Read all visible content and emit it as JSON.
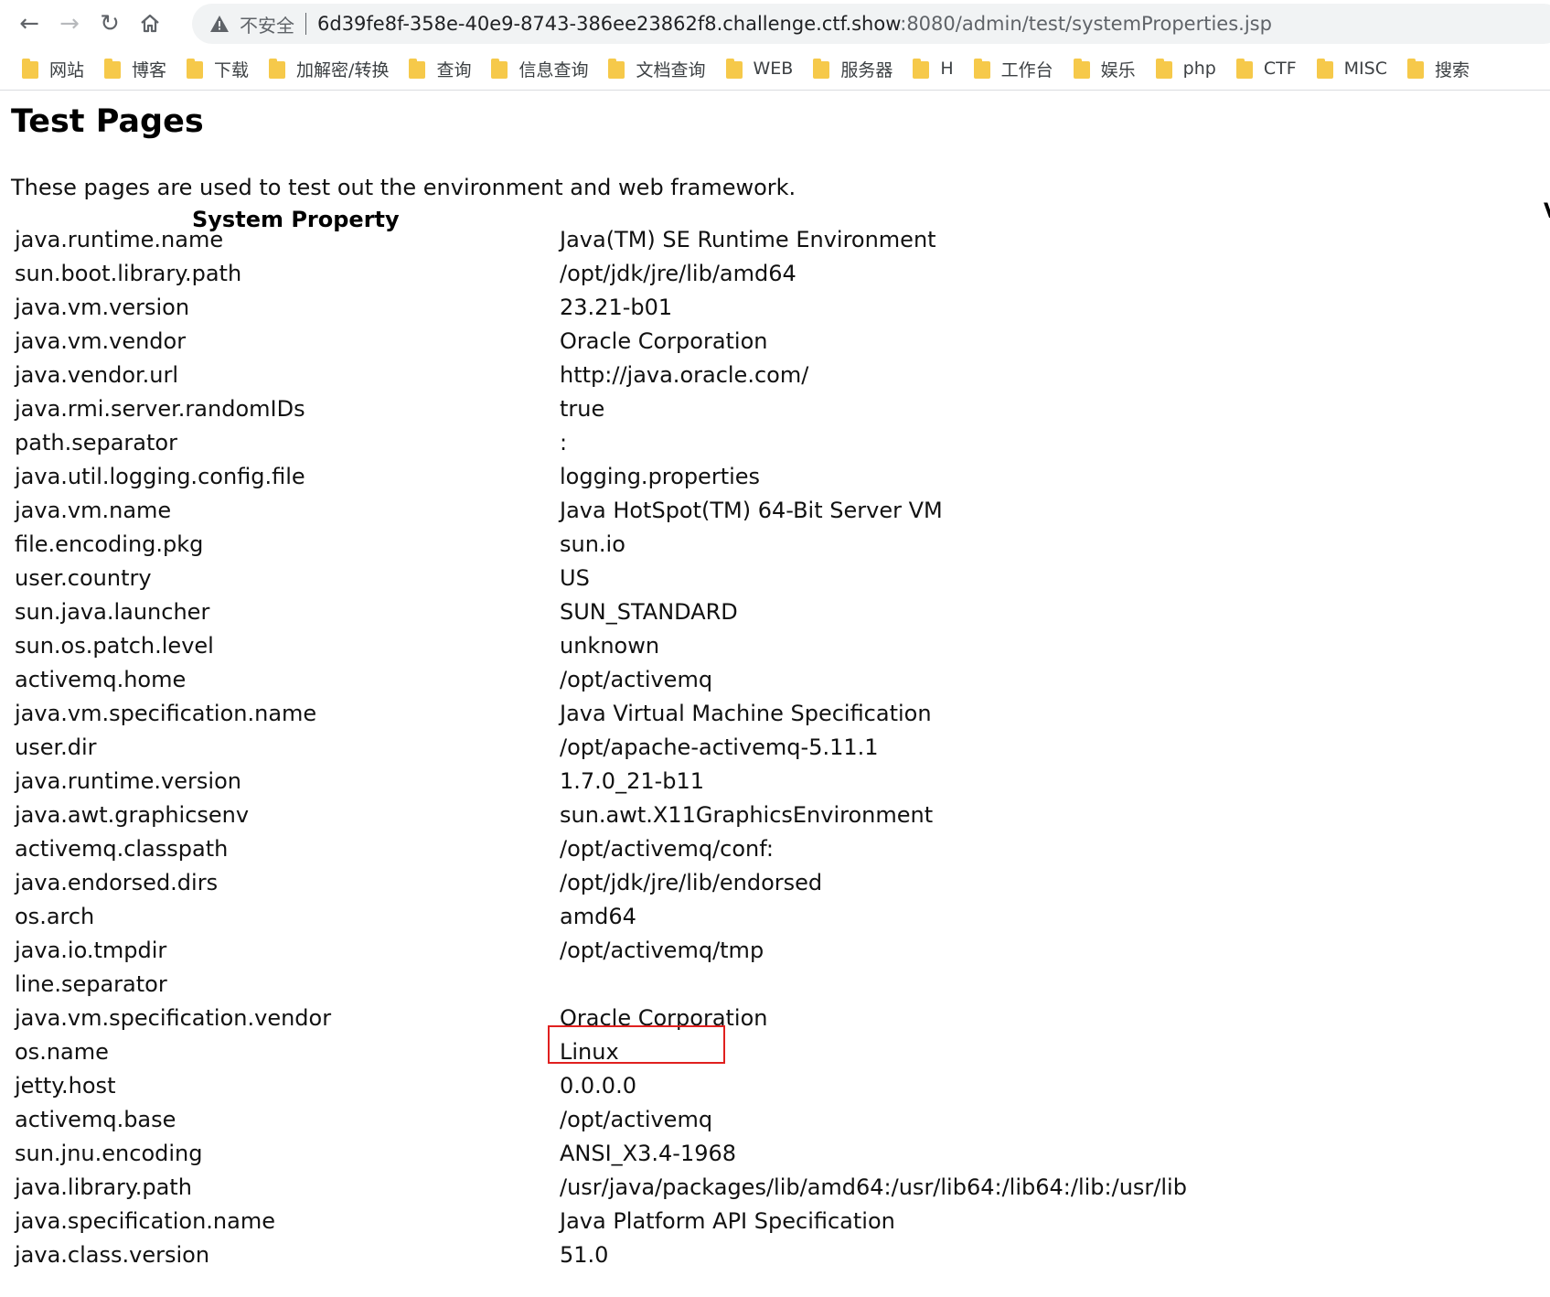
{
  "browser": {
    "security_label": "不安全",
    "url_host": "6d39fe8f-358e-40e9-8743-386ee23862f8.challenge.ctf.show",
    "url_rest": ":8080/admin/test/systemProperties.jsp",
    "bookmarks": [
      "网站",
      "博客",
      "下载",
      "加解密/转换",
      "查询",
      "信息查询",
      "文档查询",
      "WEB",
      "服务器",
      "H",
      "工作台",
      "娱乐",
      "php",
      "CTF",
      "MISC",
      "搜索"
    ]
  },
  "page": {
    "title": "Test Pages",
    "intro": "These pages are used to test out the environment and web framework.",
    "column_header": "System Property",
    "right_sliver": "V"
  },
  "properties": [
    {
      "key": "java.runtime.name",
      "value": "Java(TM) SE Runtime Environment"
    },
    {
      "key": "sun.boot.library.path",
      "value": "/opt/jdk/jre/lib/amd64"
    },
    {
      "key": "java.vm.version",
      "value": "23.21-b01"
    },
    {
      "key": "java.vm.vendor",
      "value": "Oracle Corporation"
    },
    {
      "key": "java.vendor.url",
      "value": "http://java.oracle.com/"
    },
    {
      "key": "java.rmi.server.randomIDs",
      "value": "true"
    },
    {
      "key": "path.separator",
      "value": ":"
    },
    {
      "key": "java.util.logging.config.file",
      "value": "logging.properties"
    },
    {
      "key": "java.vm.name",
      "value": "Java HotSpot(TM) 64-Bit Server VM"
    },
    {
      "key": "file.encoding.pkg",
      "value": "sun.io"
    },
    {
      "key": "user.country",
      "value": "US"
    },
    {
      "key": "sun.java.launcher",
      "value": "SUN_STANDARD"
    },
    {
      "key": "sun.os.patch.level",
      "value": "unknown"
    },
    {
      "key": "activemq.home",
      "value": "/opt/activemq"
    },
    {
      "key": "java.vm.specification.name",
      "value": "Java Virtual Machine Specification"
    },
    {
      "key": "user.dir",
      "value": "/opt/apache-activemq-5.11.1"
    },
    {
      "key": "java.runtime.version",
      "value": "1.7.0_21-b11"
    },
    {
      "key": "java.awt.graphicsenv",
      "value": "sun.awt.X11GraphicsEnvironment"
    },
    {
      "key": "activemq.classpath",
      "value": "/opt/activemq/conf:"
    },
    {
      "key": "java.endorsed.dirs",
      "value": "/opt/jdk/jre/lib/endorsed"
    },
    {
      "key": "os.arch",
      "value": "amd64"
    },
    {
      "key": "java.io.tmpdir",
      "value": "/opt/activemq/tmp"
    },
    {
      "key": "line.separator",
      "value": ""
    },
    {
      "key": "java.vm.specification.vendor",
      "value": "Oracle Corporation"
    },
    {
      "key": "os.name",
      "value": "Linux"
    },
    {
      "key": "jetty.host",
      "value": "0.0.0.0"
    },
    {
      "key": "activemq.base",
      "value": "/opt/activemq"
    },
    {
      "key": "sun.jnu.encoding",
      "value": "ANSI_X3.4-1968"
    },
    {
      "key": "java.library.path",
      "value": "/usr/java/packages/lib/amd64:/usr/lib64:/lib64:/lib:/usr/lib"
    },
    {
      "key": "java.specification.name",
      "value": "Java Platform API Specification"
    },
    {
      "key": "java.class.version",
      "value": "51.0"
    }
  ],
  "highlight_color": "#e0201f"
}
